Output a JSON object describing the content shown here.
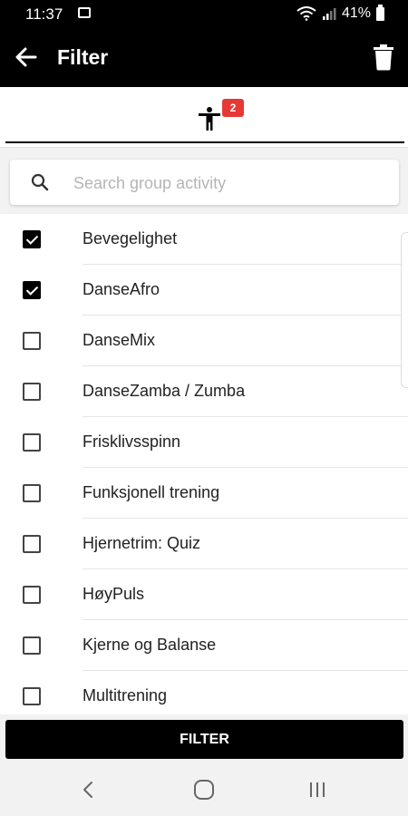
{
  "status_bar": {
    "time": "11:37",
    "battery": "41%"
  },
  "app_bar": {
    "title": "Filter"
  },
  "tab": {
    "badge": "2"
  },
  "search": {
    "placeholder": "Search group activity"
  },
  "activities": [
    {
      "label": "Bevegelighet",
      "checked": true
    },
    {
      "label": "DanseAfro",
      "checked": true
    },
    {
      "label": "DanseMix",
      "checked": false
    },
    {
      "label": "DanseZamba / Zumba",
      "checked": false
    },
    {
      "label": "Frisklivsspinn",
      "checked": false
    },
    {
      "label": "Funksjonell trening",
      "checked": false
    },
    {
      "label": "Hjernetrim: Quiz",
      "checked": false
    },
    {
      "label": "HøyPuls",
      "checked": false
    },
    {
      "label": "Kjerne og Balanse",
      "checked": false
    },
    {
      "label": "Multitrening",
      "checked": false
    }
  ],
  "filter_button": {
    "label": "FILTER"
  },
  "colors": {
    "accent": "#000000",
    "badge": "#e53935"
  },
  "icons": [
    "back-arrow-icon",
    "trash-icon",
    "person-icon",
    "search-icon",
    "nav-back-icon",
    "nav-home-icon",
    "nav-recents-icon"
  ]
}
